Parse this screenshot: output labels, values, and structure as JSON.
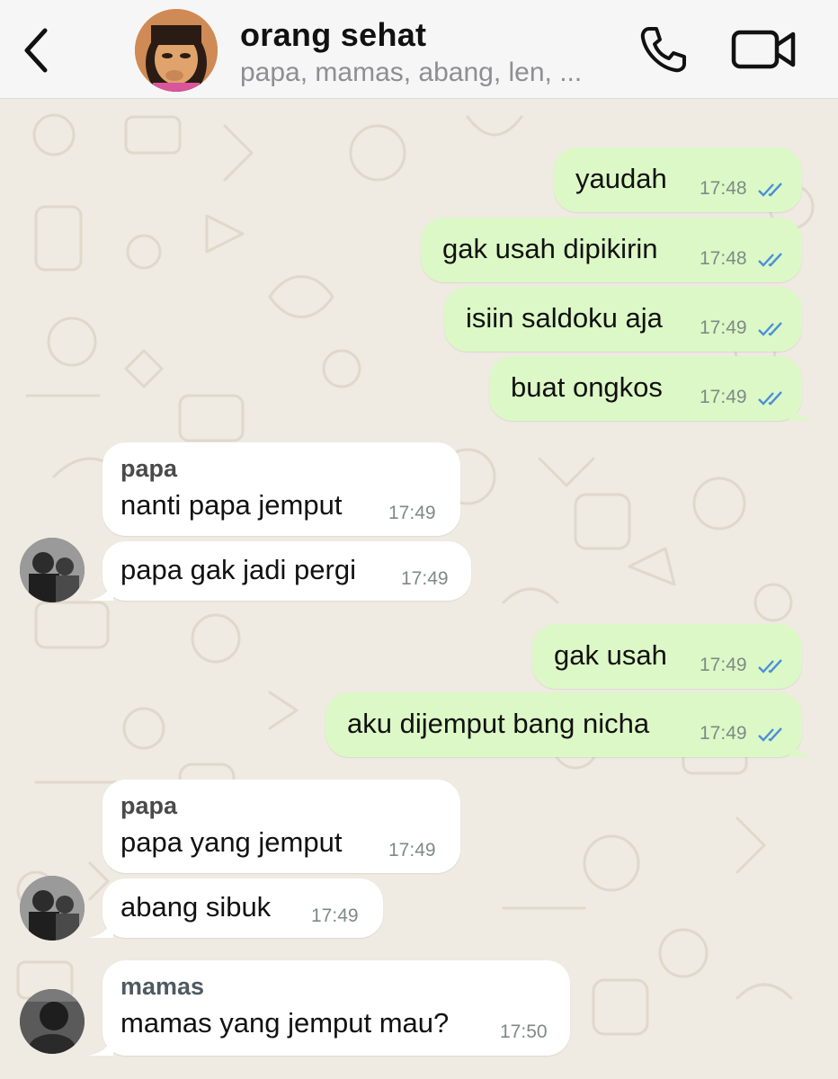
{
  "header": {
    "title": "orang sehat",
    "members": "papa, mamas, abang, len, ...",
    "back_icon": "chevron-left-icon",
    "call_icon": "phone-icon",
    "video_icon": "video-camera-icon"
  },
  "colors": {
    "outgoing_bubble": "#dcf8c6",
    "incoming_bubble": "#ffffff",
    "read_ticks": "#4a90d9",
    "wallpaper": "#efeae2"
  },
  "messages": [
    {
      "dir": "out",
      "text": "yaudah",
      "time": "17:48",
      "status": "read"
    },
    {
      "dir": "out",
      "text": "gak usah dipikirin",
      "time": "17:48",
      "status": "read"
    },
    {
      "dir": "out",
      "text": "isiin saldoku aja",
      "time": "17:49",
      "status": "read"
    },
    {
      "dir": "out",
      "text": "buat ongkos",
      "time": "17:49",
      "status": "read"
    },
    {
      "dir": "in",
      "sender": "papa",
      "text": "nanti papa jemput",
      "time": "17:49"
    },
    {
      "dir": "in",
      "text": "papa gak jadi pergi",
      "time": "17:49"
    },
    {
      "dir": "out",
      "text": "gak usah",
      "time": "17:49",
      "status": "read"
    },
    {
      "dir": "out",
      "text": "aku dijemput bang nicha",
      "time": "17:49",
      "status": "read"
    },
    {
      "dir": "in",
      "sender": "papa",
      "text": "papa yang jemput",
      "time": "17:49"
    },
    {
      "dir": "in",
      "text": "abang sibuk",
      "time": "17:49"
    },
    {
      "dir": "in",
      "sender": "mamas",
      "text": "mamas yang jemput mau?",
      "time": "17:50"
    }
  ]
}
